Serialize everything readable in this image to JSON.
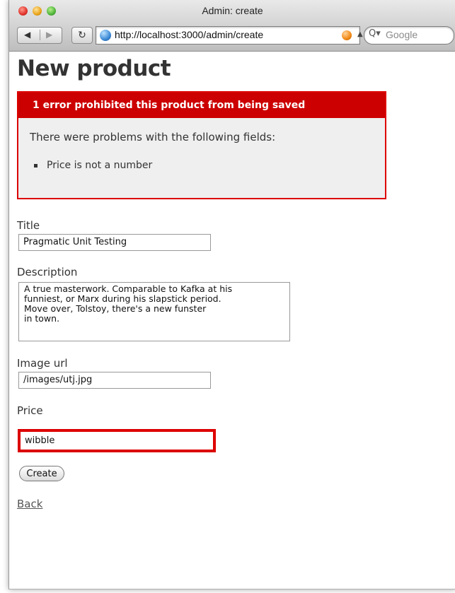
{
  "window": {
    "title": "Admin: create"
  },
  "toolbar": {
    "back_arrow": "◀",
    "forward_arrow": "▶",
    "reload_icon": "reload-icon",
    "url": "http://localhost:3000/admin/create",
    "search_placeholder": "Google"
  },
  "page": {
    "heading": "New product",
    "error_box": {
      "header": "1 error prohibited this product from being saved",
      "intro": "There were problems with the following fields:",
      "errors": [
        "Price is not a number"
      ]
    },
    "form": {
      "title_label": "Title",
      "title_value": "Pragmatic Unit Testing",
      "description_label": "Description",
      "description_value": "A true masterwork. Comparable to Kafka at his\nfunniest, or Marx during his slapstick period.\nMove over, Tolstoy, there's a new funster\nin town.",
      "image_url_label": "Image url",
      "image_url_value": "/images/utj.jpg",
      "price_label": "Price",
      "price_value": "wibble",
      "submit_label": "Create"
    },
    "back_link": "Back"
  },
  "colors": {
    "error_red": "#cc0000",
    "error_bg": "#efefef"
  }
}
